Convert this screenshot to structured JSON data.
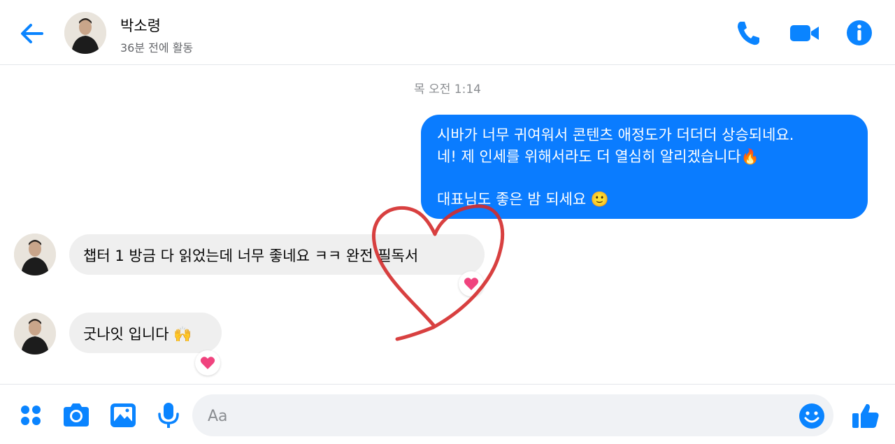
{
  "header": {
    "name": "박소령",
    "status": "36분 전에 활동"
  },
  "thread": {
    "timestamp": "목 오전 1:14",
    "outgoing": {
      "line1": "시바가 너무 귀여워서 콘텐츠 애정도가 더더더 상승되네요.",
      "line2": "네! 제 인세를 위해서라도 더 열심히 알리겠습니다🔥",
      "line3": "대표님도 좋은 밤 되세요 🙂"
    },
    "incoming": [
      {
        "text": "챕터 1 방금 다 읽었는데 너무 좋네요 ㅋㅋ 완전 필독서",
        "reaction": "heart"
      },
      {
        "text": "굿나잇 입니다 🙌",
        "reaction": "heart"
      }
    ]
  },
  "composer": {
    "placeholder": "Aa"
  },
  "icons": {
    "header": [
      "back-arrow-icon",
      "phone-icon",
      "video-camera-icon",
      "info-icon"
    ],
    "footer": [
      "more-apps-icon",
      "camera-icon",
      "gallery-icon",
      "microphone-icon",
      "emoji-icon",
      "thumbs-up-icon"
    ]
  },
  "colors": {
    "accent": "#0a84ff",
    "outgoing_bubble": "#0a7cff",
    "incoming_bubble": "#efefef",
    "reaction_heart": "#f0437e",
    "drawn_heart": "#d42b2b"
  }
}
